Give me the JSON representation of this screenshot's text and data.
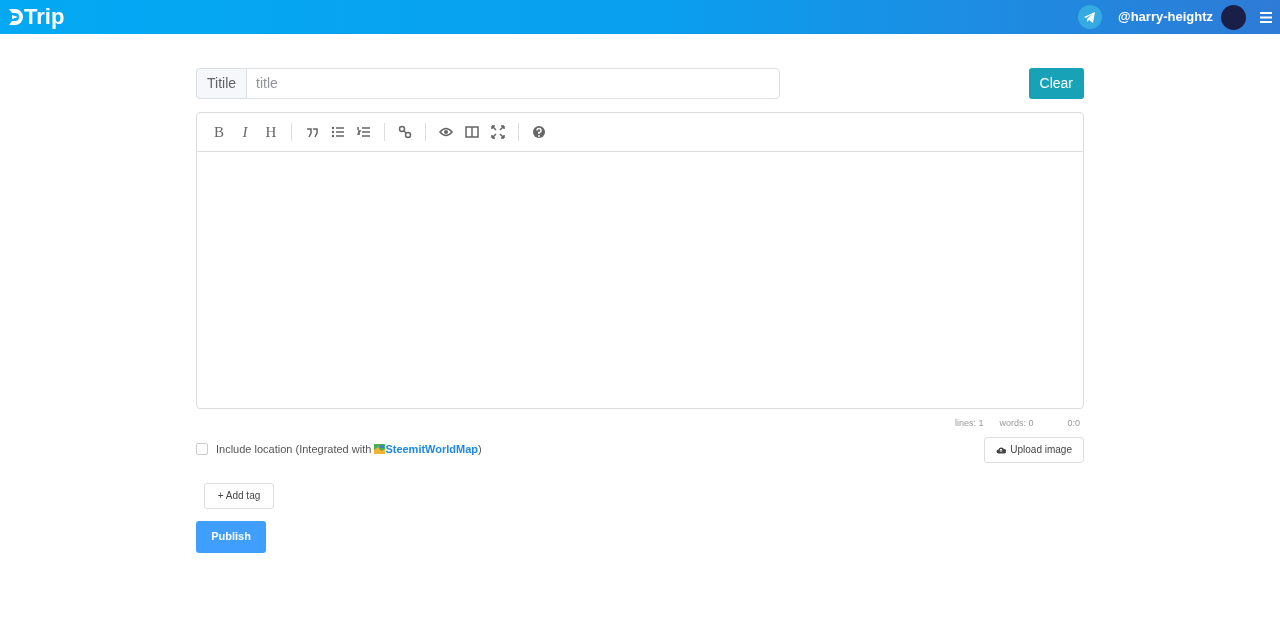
{
  "header": {
    "logo": "Trip",
    "username": "@harry-heightz"
  },
  "title_field": {
    "label": "Titile",
    "placeholder": "title"
  },
  "clear_button": "Clear",
  "toolbar": [
    {
      "kind": "text",
      "label": "B"
    },
    {
      "kind": "text",
      "label": "I"
    },
    {
      "kind": "text",
      "label": "H"
    }
  ],
  "status_bar": [
    "lines: 1",
    "words: 0",
    "0:0"
  ],
  "location": {
    "checked": false,
    "text": "Include location (Integrated with ",
    "link": "SteemitWorldMap",
    "end": ")"
  },
  "upload_button": "Upload image",
  "add_tag_button": "+ Add tag",
  "publish_button": "Publish"
}
